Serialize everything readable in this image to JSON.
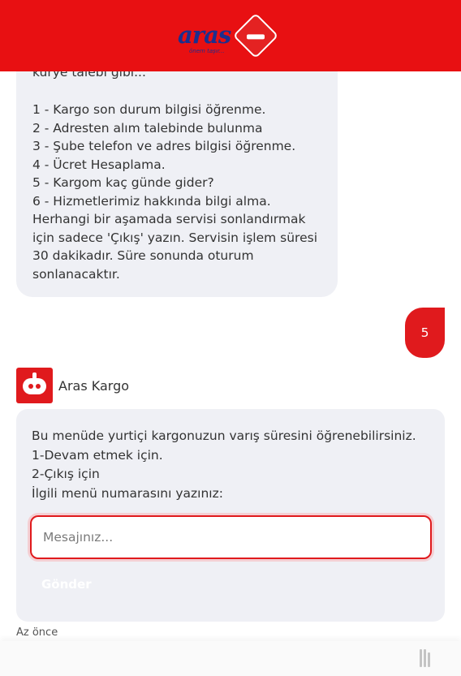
{
  "header": {
    "logo_text": "aras",
    "logo_tagline": "önem taşır..."
  },
  "messages": {
    "bot_1": {
      "cut_line": "kurye talebi gibi...",
      "menu_items": [
        "1 - Kargo son durum bilgisi öğrenme.",
        "2 - Adresten alım talebinde bulunma",
        "3 - Şube telefon ve adres bilgisi öğrenme.",
        "4 - Ücret Hesaplama.",
        "5 - Kargom kaç günde gider?",
        "6 - Hizmetlerimiz hakkında bilgi alma."
      ],
      "note_lines": [
        "Herhangi bir aşamada servisi sonlandırmak",
        "için sadece 'Çıkış' yazın. Servisin işlem süresi",
        "30 dakikadır. Süre sonunda oturum",
        "sonlanacaktır."
      ]
    },
    "user_1": {
      "text": "5"
    },
    "bot_2": {
      "sender": "Aras Kargo",
      "lines": [
        "Bu menüde yurtiçi kargonuzun varış süresini öğrenebilirsiniz.",
        "1-Devam etmek için.",
        "2-Çıkış için",
        "İlgili menü numarasını yazınız:"
      ],
      "input": {
        "value": "",
        "placeholder": "Mesajınız..."
      },
      "send_label": "Gönder",
      "timestamp": "Az önce"
    }
  },
  "colors": {
    "brand_red": "#e81012",
    "brand_blue": "#1c2f8e",
    "bubble_gray": "#eff0f5"
  }
}
